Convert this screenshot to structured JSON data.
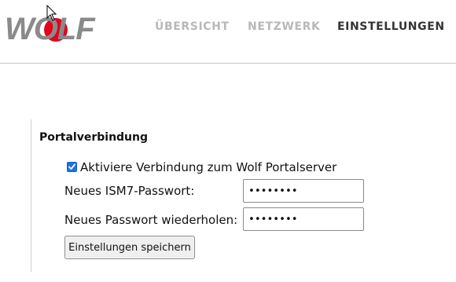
{
  "header": {
    "logo_text": "WOLF",
    "nav": [
      {
        "label": "ÜBERSICHT",
        "active": false
      },
      {
        "label": "NETZWERK",
        "active": false
      },
      {
        "label": "EINSTELLUNGEN",
        "active": true
      }
    ]
  },
  "portal": {
    "section_title": "Portalverbindung",
    "checkbox_label": "Aktiviere Verbindung zum Wolf Portalserver",
    "checkbox_checked": true,
    "new_password_label": "Neues ISM7-Passwort:",
    "new_password_value": "••••••••",
    "repeat_password_label": "Neues Passwort wiederholen:",
    "repeat_password_value": "••••••••",
    "save_label": "Einstellungen speichern"
  },
  "colors": {
    "logo_gray": "#8a8a8a",
    "logo_red": "#e3051b",
    "nav_inactive": "#b8b8b8",
    "nav_active": "#333333",
    "checkbox_accent": "#1a73e8"
  }
}
